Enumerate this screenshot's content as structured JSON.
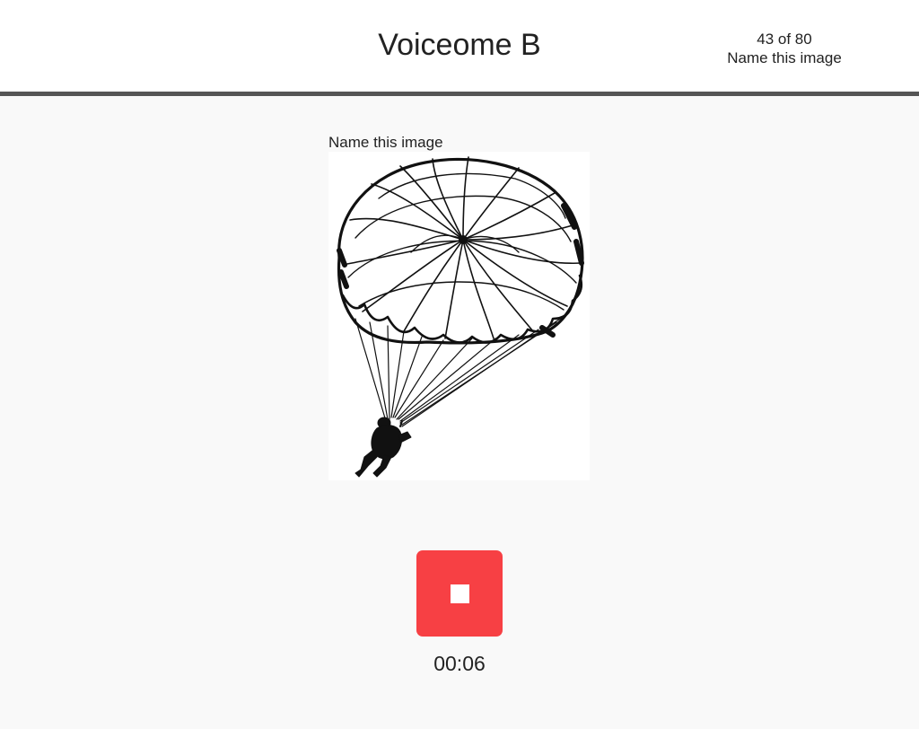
{
  "header": {
    "title": "Voiceome B",
    "progress_count": "43 of 80",
    "progress_task": "Name this image"
  },
  "task": {
    "prompt": "Name this image",
    "image_subject": "parachute-line-drawing"
  },
  "recorder": {
    "state": "recording",
    "button_icon": "stop-icon",
    "elapsed": "00:06",
    "accent_color": "#f74044"
  }
}
